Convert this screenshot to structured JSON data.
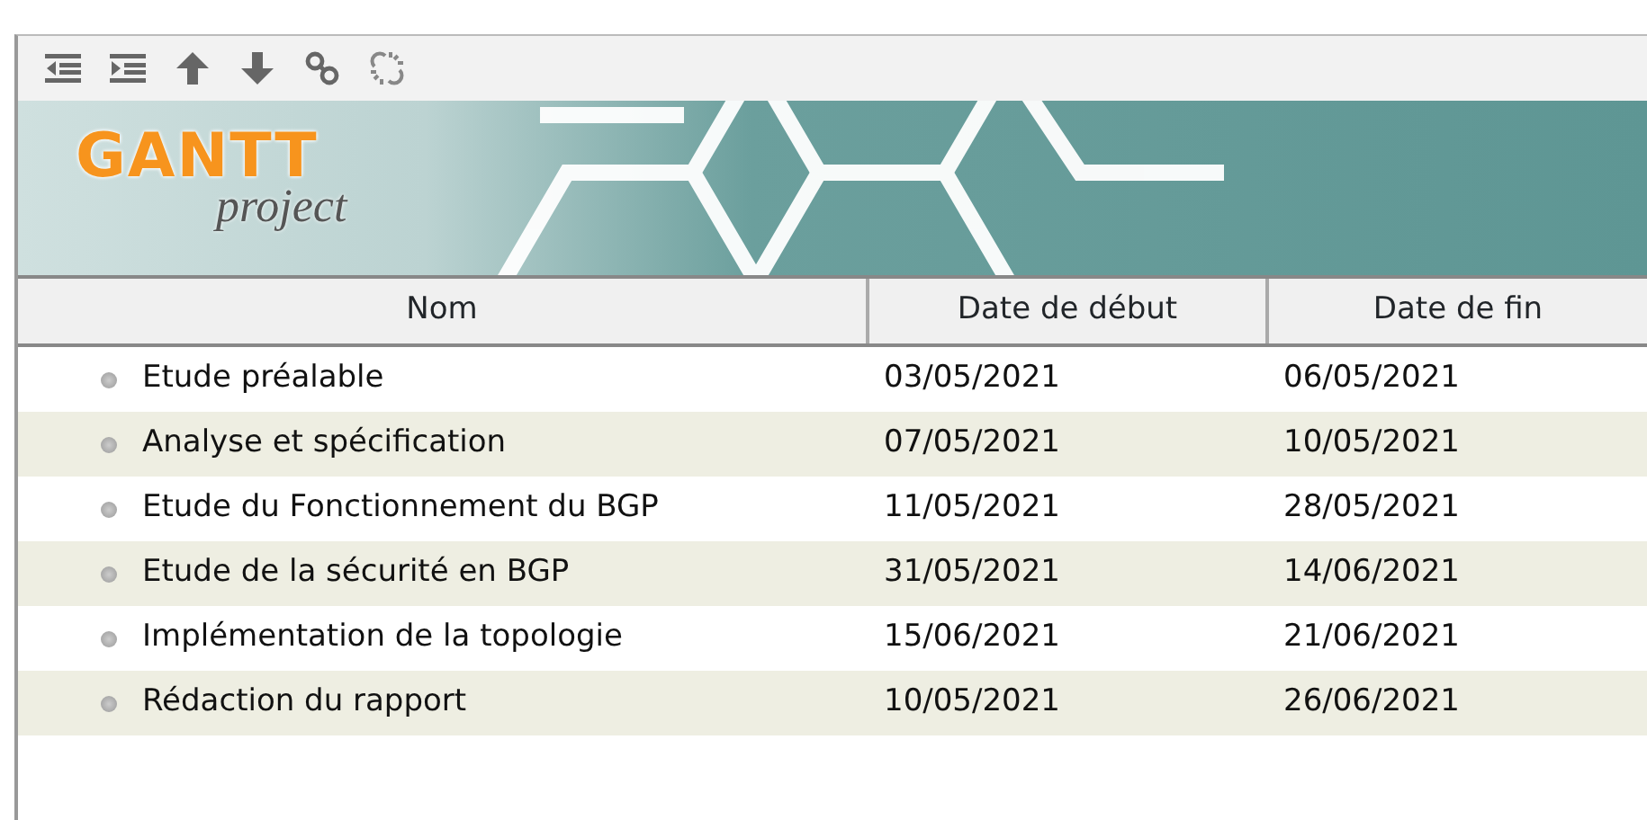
{
  "toolbar": {
    "buttons": [
      {
        "kind": "unindent"
      },
      {
        "kind": "indent"
      },
      {
        "kind": "up"
      },
      {
        "kind": "down"
      },
      {
        "kind": "link"
      },
      {
        "kind": "unlink"
      }
    ]
  },
  "banner": {
    "logo_title": "GANTT",
    "logo_subtitle": "project"
  },
  "table": {
    "columns": [
      "Nom",
      "Date de début",
      "Date de fin"
    ],
    "rows": [
      {
        "name": "Etude préalable",
        "start": "03/05/2021",
        "end": "06/05/2021"
      },
      {
        "name": "Analyse et spécification",
        "start": "07/05/2021",
        "end": "10/05/2021"
      },
      {
        "name": "Etude du Fonctionnement du BGP",
        "start": "11/05/2021",
        "end": "28/05/2021"
      },
      {
        "name": "Etude de la sécurité en BGP",
        "start": "31/05/2021",
        "end": "14/06/2021"
      },
      {
        "name": "Implémentation de la topologie",
        "start": "15/06/2021",
        "end": "21/06/2021"
      },
      {
        "name": "Rédaction du rapport",
        "start": "10/05/2021",
        "end": "26/06/2021"
      }
    ]
  }
}
